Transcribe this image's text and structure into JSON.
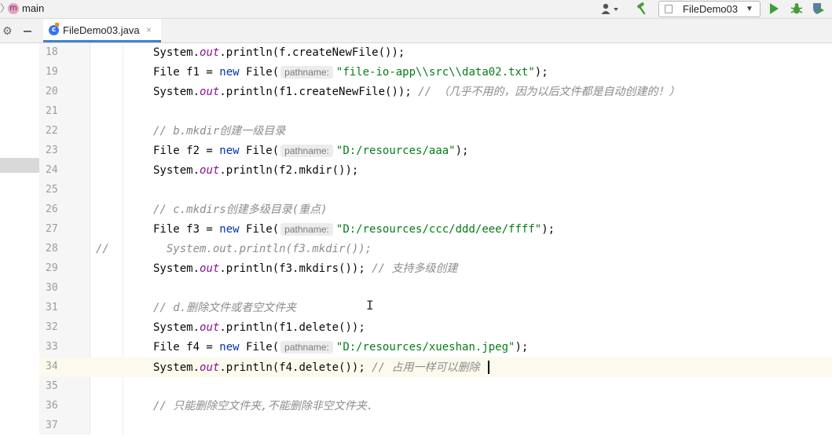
{
  "navbar": {
    "module_icon": "m",
    "project": "main",
    "user_icon": "user-dropdown-icon",
    "run_config": "FileDemo03"
  },
  "tab": {
    "file_name": "FileDemo03.java",
    "close": "×"
  },
  "editor": {
    "current_line": 34,
    "lines": [
      {
        "n": "18",
        "lead": "",
        "tokens": [
          {
            "t": "System."
          },
          {
            "t": "out",
            "c": "fld"
          },
          {
            "t": ".println(f.createNewFile());"
          }
        ]
      },
      {
        "n": "19",
        "lead": "",
        "tokens": [
          {
            "t": "File f1 = "
          },
          {
            "t": "new",
            "c": "kw"
          },
          {
            "t": " File("
          },
          {
            "t": "pathname:",
            "c": "hint"
          },
          {
            "t": "\"file-io-app\\\\src\\\\data02.txt\"",
            "c": "str"
          },
          {
            "t": ");"
          }
        ]
      },
      {
        "n": "20",
        "lead": "",
        "tokens": [
          {
            "t": "System."
          },
          {
            "t": "out",
            "c": "fld"
          },
          {
            "t": ".println(f1.createNewFile()); "
          },
          {
            "t": "// （几乎不用的，因为以后文件都是自动创建的！）",
            "c": "cmt"
          }
        ]
      },
      {
        "n": "21",
        "lead": "",
        "tokens": []
      },
      {
        "n": "22",
        "lead": "",
        "tokens": [
          {
            "t": "// b.mkdir创建一级目录",
            "c": "cmt"
          }
        ]
      },
      {
        "n": "23",
        "lead": "",
        "tokens": [
          {
            "t": "File f2 = "
          },
          {
            "t": "new",
            "c": "kw"
          },
          {
            "t": " File("
          },
          {
            "t": "pathname:",
            "c": "hint"
          },
          {
            "t": "\"D:/resources/aaa\"",
            "c": "str"
          },
          {
            "t": ");"
          }
        ]
      },
      {
        "n": "24",
        "lead": "",
        "tokens": [
          {
            "t": "System."
          },
          {
            "t": "out",
            "c": "fld"
          },
          {
            "t": ".println(f2.mkdir());"
          }
        ]
      },
      {
        "n": "25",
        "lead": "",
        "tokens": []
      },
      {
        "n": "26",
        "lead": "",
        "tokens": [
          {
            "t": "// c.mkdirs创建多级目录(重点)",
            "c": "cmt"
          }
        ]
      },
      {
        "n": "27",
        "lead": "",
        "tokens": [
          {
            "t": "File f3 = "
          },
          {
            "t": "new",
            "c": "kw"
          },
          {
            "t": " File("
          },
          {
            "t": "pathname:",
            "c": "hint"
          },
          {
            "t": "\"D:/resources/ccc/ddd/eee/ffff\"",
            "c": "str"
          },
          {
            "t": ");"
          }
        ]
      },
      {
        "n": "28",
        "lead": "//",
        "tokens": [
          {
            "t": "  System.out.println(f3.mkdir());",
            "c": "cmt"
          }
        ]
      },
      {
        "n": "29",
        "lead": "",
        "tokens": [
          {
            "t": "System."
          },
          {
            "t": "out",
            "c": "fld"
          },
          {
            "t": ".println(f3.mkdirs()); "
          },
          {
            "t": "// 支持多级创建",
            "c": "cmt"
          }
        ]
      },
      {
        "n": "30",
        "lead": "",
        "tokens": []
      },
      {
        "n": "31",
        "lead": "",
        "tokens": [
          {
            "t": "// d.删除文件或者空文件夹",
            "c": "cmt"
          }
        ]
      },
      {
        "n": "32",
        "lead": "",
        "tokens": [
          {
            "t": "System."
          },
          {
            "t": "out",
            "c": "fld"
          },
          {
            "t": ".println(f1.delete());"
          }
        ]
      },
      {
        "n": "33",
        "lead": "",
        "tokens": [
          {
            "t": "File f4 = "
          },
          {
            "t": "new",
            "c": "kw"
          },
          {
            "t": " File("
          },
          {
            "t": "pathname:",
            "c": "hint"
          },
          {
            "t": "\"D:/resources/xueshan.jpeg\"",
            "c": "str"
          },
          {
            "t": ");"
          }
        ]
      },
      {
        "n": "34",
        "lead": "",
        "tokens": [
          {
            "t": "System."
          },
          {
            "t": "out",
            "c": "fld"
          },
          {
            "t": ".println(f4.delete()); "
          },
          {
            "t": "// 占用一样可以删除 ",
            "c": "cmt"
          }
        ]
      },
      {
        "n": "35",
        "lead": "",
        "tokens": []
      },
      {
        "n": "36",
        "lead": "",
        "tokens": [
          {
            "t": "// 只能删除空文件夹,不能删除非空文件夹.",
            "c": "cmt"
          }
        ]
      },
      {
        "n": "37",
        "lead": "",
        "tokens": []
      }
    ]
  },
  "cursor_text": "I"
}
